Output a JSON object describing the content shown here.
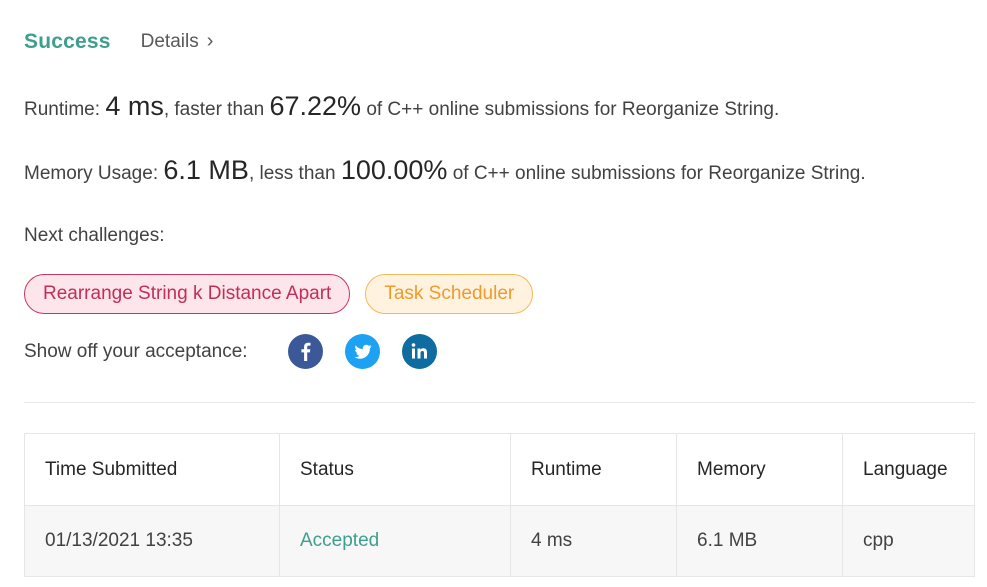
{
  "header": {
    "status": "Success",
    "details_label": "Details",
    "details_icon": "chevron-right-icon"
  },
  "runtime": {
    "label": "Runtime:",
    "value": "4 ms",
    "comparison": ", faster than",
    "percent": "67.22%",
    "suffix": "of C++ online submissions for Reorganize String."
  },
  "memory": {
    "label": "Memory Usage:",
    "value": "6.1 MB",
    "comparison": ", less than",
    "percent": "100.00%",
    "suffix": "of C++ online submissions for Reorganize String."
  },
  "next_challenges": {
    "label": "Next challenges:",
    "items": [
      {
        "title": "Rearrange String k Distance Apart",
        "difficulty_color": "#c22e56"
      },
      {
        "title": "Task Scheduler",
        "difficulty_color": "#f19a2c"
      }
    ]
  },
  "share": {
    "label": "Show off your acceptance:",
    "icons": [
      "facebook-icon",
      "twitter-icon",
      "linkedin-icon"
    ],
    "colors": {
      "facebook": "#3b5998",
      "twitter": "#1da1f2",
      "linkedin": "#0e6ca0"
    }
  },
  "submissions": {
    "columns": [
      "Time Submitted",
      "Status",
      "Runtime",
      "Memory",
      "Language"
    ],
    "rows": [
      {
        "time": "01/13/2021 13:35",
        "status": "Accepted",
        "runtime": "4 ms",
        "memory": "6.1 MB",
        "language": "cpp"
      }
    ]
  },
  "colors": {
    "success": "#3e9e8f",
    "accepted": "#3e9e8f"
  }
}
